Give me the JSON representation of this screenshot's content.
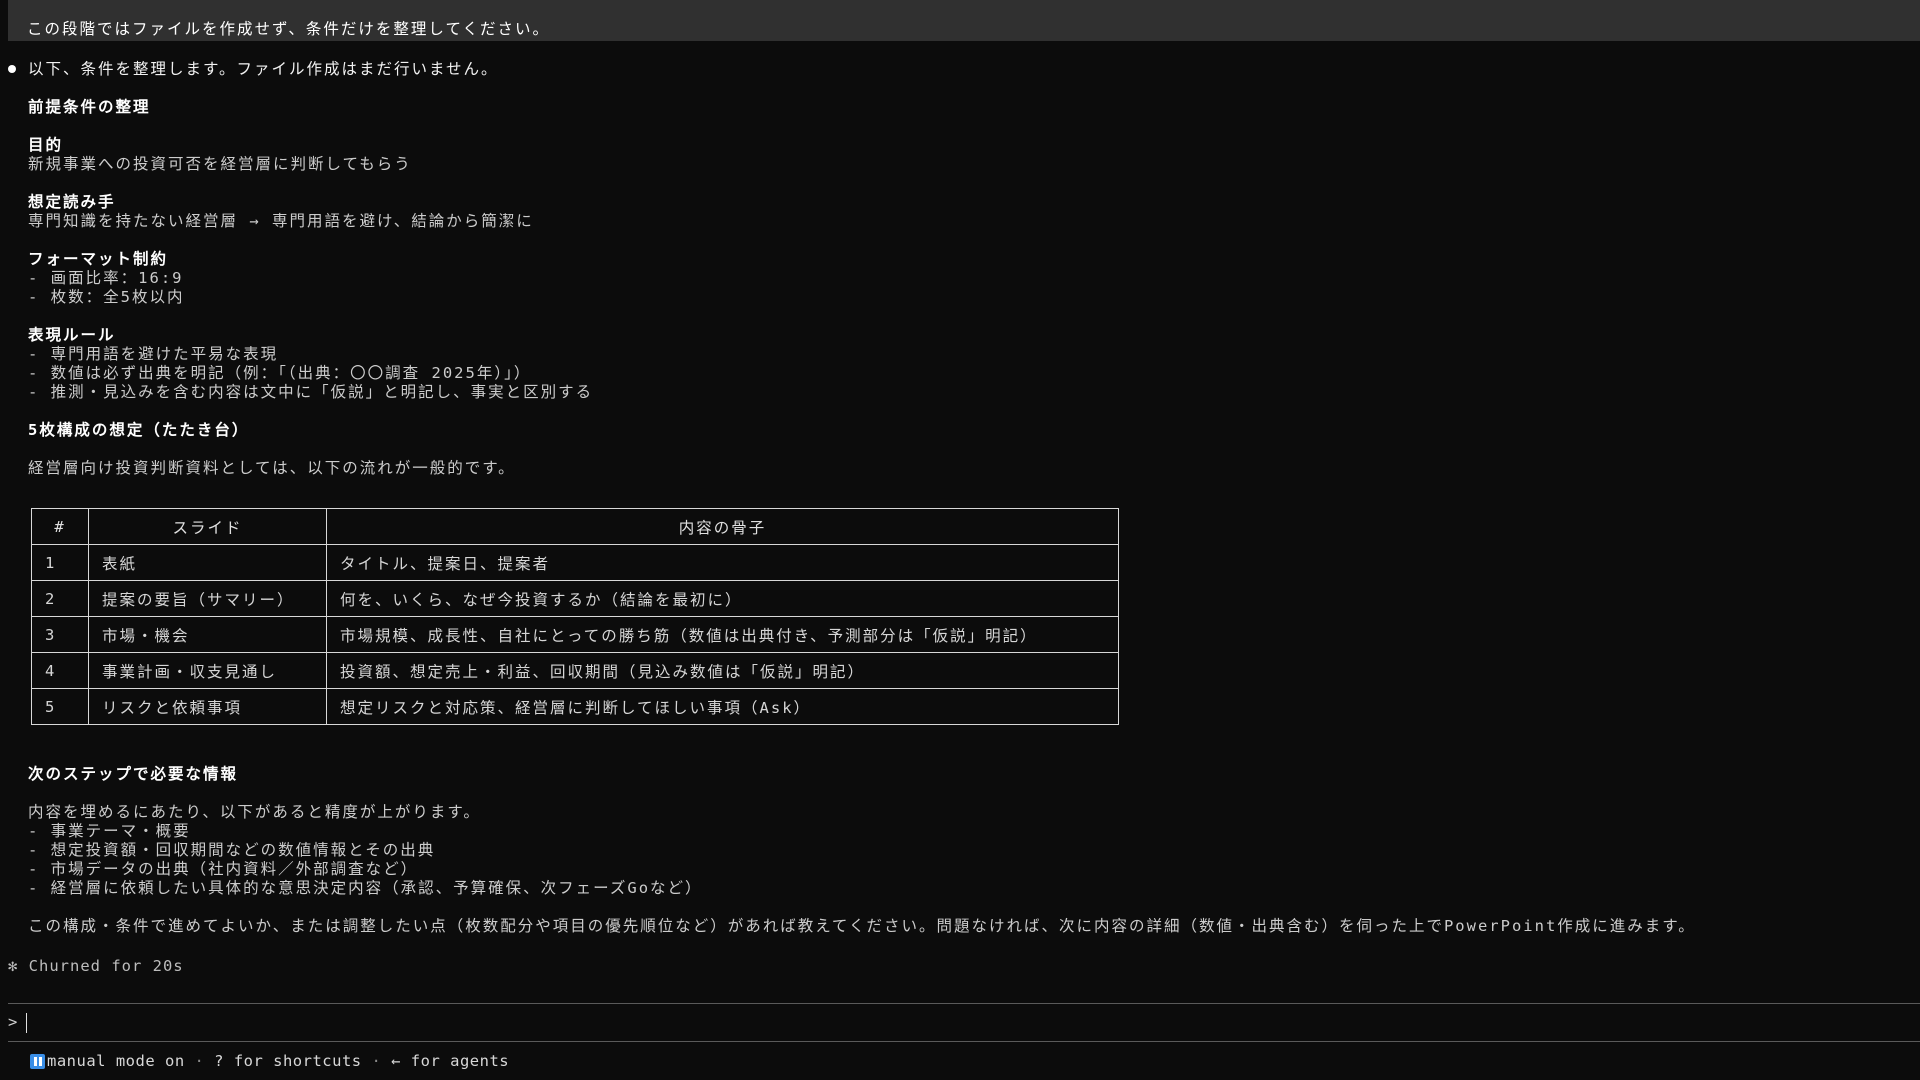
{
  "user_message": {
    "faded_above": "─ ─ ─ ─ ─ ─ ─ ─ ─ ─ ─ ─",
    "text": "この段階ではファイルを作成せず、条件だけを整理してください。"
  },
  "response": {
    "intro": "以下、条件を整理します。ファイル作成はまだ行いません。",
    "section1_heading": "前提条件の整理",
    "purpose_heading": "目的",
    "purpose_text": "新規事業への投資可否を経営層に判断してもらう",
    "reader_heading": "想定読み手",
    "reader_text": "専門知識を持たない経営層 → 専門用語を避け、結論から簡潔に",
    "format_heading": "フォーマット制約",
    "format_items": [
      "- 画面比率：16:9",
      "- 枚数：全5枚以内"
    ],
    "expression_heading": "表現ルール",
    "expression_items": [
      "- 専門用語を避けた平易な表現",
      "- 数値は必ず出典を明記（例：「（出典：〇〇調査 2025年）」）",
      "- 推測・見込みを含む内容は文中に「仮説」と明記し、事実と区別する"
    ],
    "section2_heading": "5枚構成の想定（たたき台）",
    "section2_intro": "経営層向け投資判断資料としては、以下の流れが一般的です。",
    "table": {
      "headers": [
        "#",
        "スライド",
        "内容の骨子"
      ],
      "rows": [
        [
          "1",
          "表紙",
          "タイトル、提案日、提案者"
        ],
        [
          "2",
          "提案の要旨（サマリー）",
          "何を、いくら、なぜ今投資するか（結論を最初に）"
        ],
        [
          "3",
          "市場・機会",
          "市場規模、成長性、自社にとっての勝ち筋（数値は出典付き、予測部分は「仮説」明記）"
        ],
        [
          "4",
          "事業計画・収支見通し",
          "投資額、想定売上・利益、回収期間（見込み数値は「仮説」明記）"
        ],
        [
          "5",
          "リスクと依頼事項",
          "想定リスクと対応策、経営層に判断してほしい事項（Ask）"
        ]
      ]
    },
    "section3_heading": "次のステップで必要な情報",
    "section3_intro": "内容を埋めるにあたり、以下があると精度が上がります。",
    "section3_items": [
      "- 事業テーマ・概要",
      "- 想定投資額・回収期間などの数値情報とその出典",
      "- 市場データの出典（社内資料／外部調査など）",
      "- 経営層に依頼したい具体的な意思決定内容（承認、予算確保、次フェーズGoなど）"
    ],
    "closing": "この構成・条件で進めてよいか、または調整したい点（枚数配分や項目の優先順位など）があれば教えてください。問題なければ、次に内容の詳細（数値・出典含む）を伺った上でPowerPoint作成に進みます。"
  },
  "churn": "✻ Churned for 20s",
  "prompt": {
    "symbol": ">",
    "value": ""
  },
  "status_bar": {
    "mode": "manual mode on",
    "sep1": " · ",
    "shortcuts": "? for shortcuts",
    "sep2": " · ",
    "agents": "← for agents"
  },
  "colors": {
    "background": "#0c0c0c",
    "user_message_bg": "#303030",
    "mode_icon": "#3a8ee6"
  }
}
